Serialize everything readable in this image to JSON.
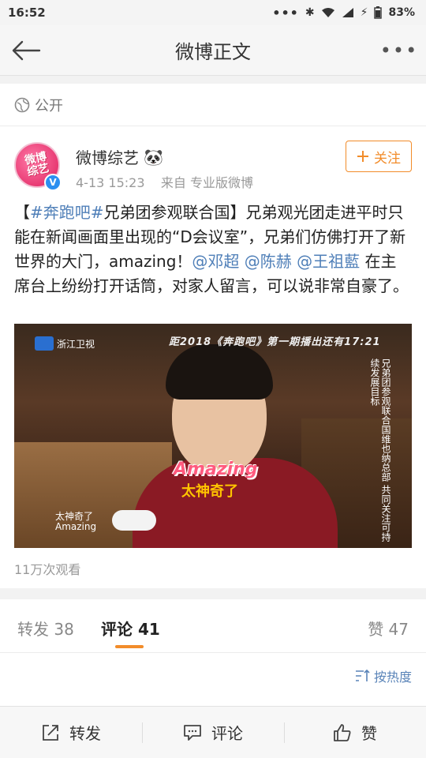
{
  "status_bar": {
    "time": "16:52",
    "dots": "•••",
    "battery": "83%"
  },
  "nav": {
    "title": "微博正文",
    "more": "•••"
  },
  "privacy": {
    "label": "公开"
  },
  "author": {
    "name": "微博综艺",
    "emoji": "🐼",
    "avatar_text": "微博\n综艺",
    "time": "4-13 15:23",
    "source": "来自 专业版微博",
    "follow_label": "关注"
  },
  "post": {
    "bracket_open": "【",
    "topic1": "#奔跑吧#",
    "title_rest": "兄弟团参观联合国】兄弟观光团走进平时只能在新闻画面里出现的“D会议室”，兄弟们仿佛打开了新世界的大门，amazing！",
    "mention1": "@邓超",
    "mention2": "@陈赫",
    "mention3": "@王祖藍",
    "tail": " 在主席台上纷纷打开话筒，对家人留言，可以说非常自豪了。"
  },
  "video": {
    "channel": "浙江卫视",
    "banner": "距2018《奔跑吧》第一期播出还有17:21",
    "side_text": "兄弟团参观联合国维也纳总部 共同关注可持续发展目标",
    "caption_en": "Amazing",
    "caption_cn": "太神奇了",
    "caption_small_cn": "太神奇了",
    "caption_small_en": "Amazing",
    "views": "11万次观看"
  },
  "tabs": {
    "repost": "转发 38",
    "comment": "评论 41",
    "like": "赞 47"
  },
  "sort": {
    "label": "按热度"
  },
  "bottom": {
    "repost": "转发",
    "comment": "评论",
    "like": "赞"
  },
  "colors": {
    "accent": "#f28c2a",
    "link": "#4f7fb8",
    "verified": "#2c8ff0"
  }
}
